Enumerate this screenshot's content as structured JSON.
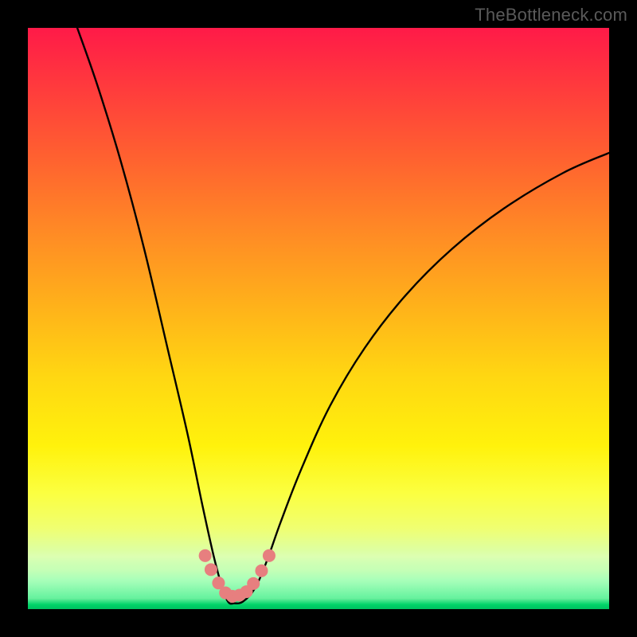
{
  "watermark": "TheBottleneck.com",
  "colors": {
    "frame": "#000000",
    "curve_stroke": "#000000",
    "marker_fill": "#e77f7f",
    "gradient_top": "#ff1a48",
    "gradient_bottom": "#00c060"
  },
  "chart_data": {
    "type": "line",
    "title": "",
    "xlabel": "",
    "ylabel": "",
    "xlim": [
      0,
      100
    ],
    "ylim": [
      0,
      100
    ],
    "grid": false,
    "legend": false,
    "series": [
      {
        "name": "bottleneck-curve",
        "x": [
          8.5,
          12,
          16,
          20,
          24,
          27.5,
          30,
          32,
          33.5,
          34.5,
          35.5,
          37,
          39,
          41,
          43.5,
          47,
          52,
          58,
          65,
          73,
          82,
          92,
          100
        ],
        "values": [
          100,
          90,
          77,
          62,
          45,
          30,
          18,
          9,
          3.5,
          1.2,
          1.0,
          1.3,
          3.5,
          8,
          15,
          24,
          35,
          45,
          54,
          62,
          69,
          75,
          78.5
        ]
      }
    ],
    "markers": {
      "name": "highlight-dots",
      "x": [
        30.5,
        31.5,
        32.8,
        34.0,
        35.2,
        36.4,
        37.6,
        38.8,
        40.2,
        41.5
      ],
      "values": [
        9.2,
        6.8,
        4.5,
        2.8,
        2.2,
        2.4,
        3.0,
        4.4,
        6.6,
        9.2
      ],
      "radius_pct": 1.1
    }
  }
}
